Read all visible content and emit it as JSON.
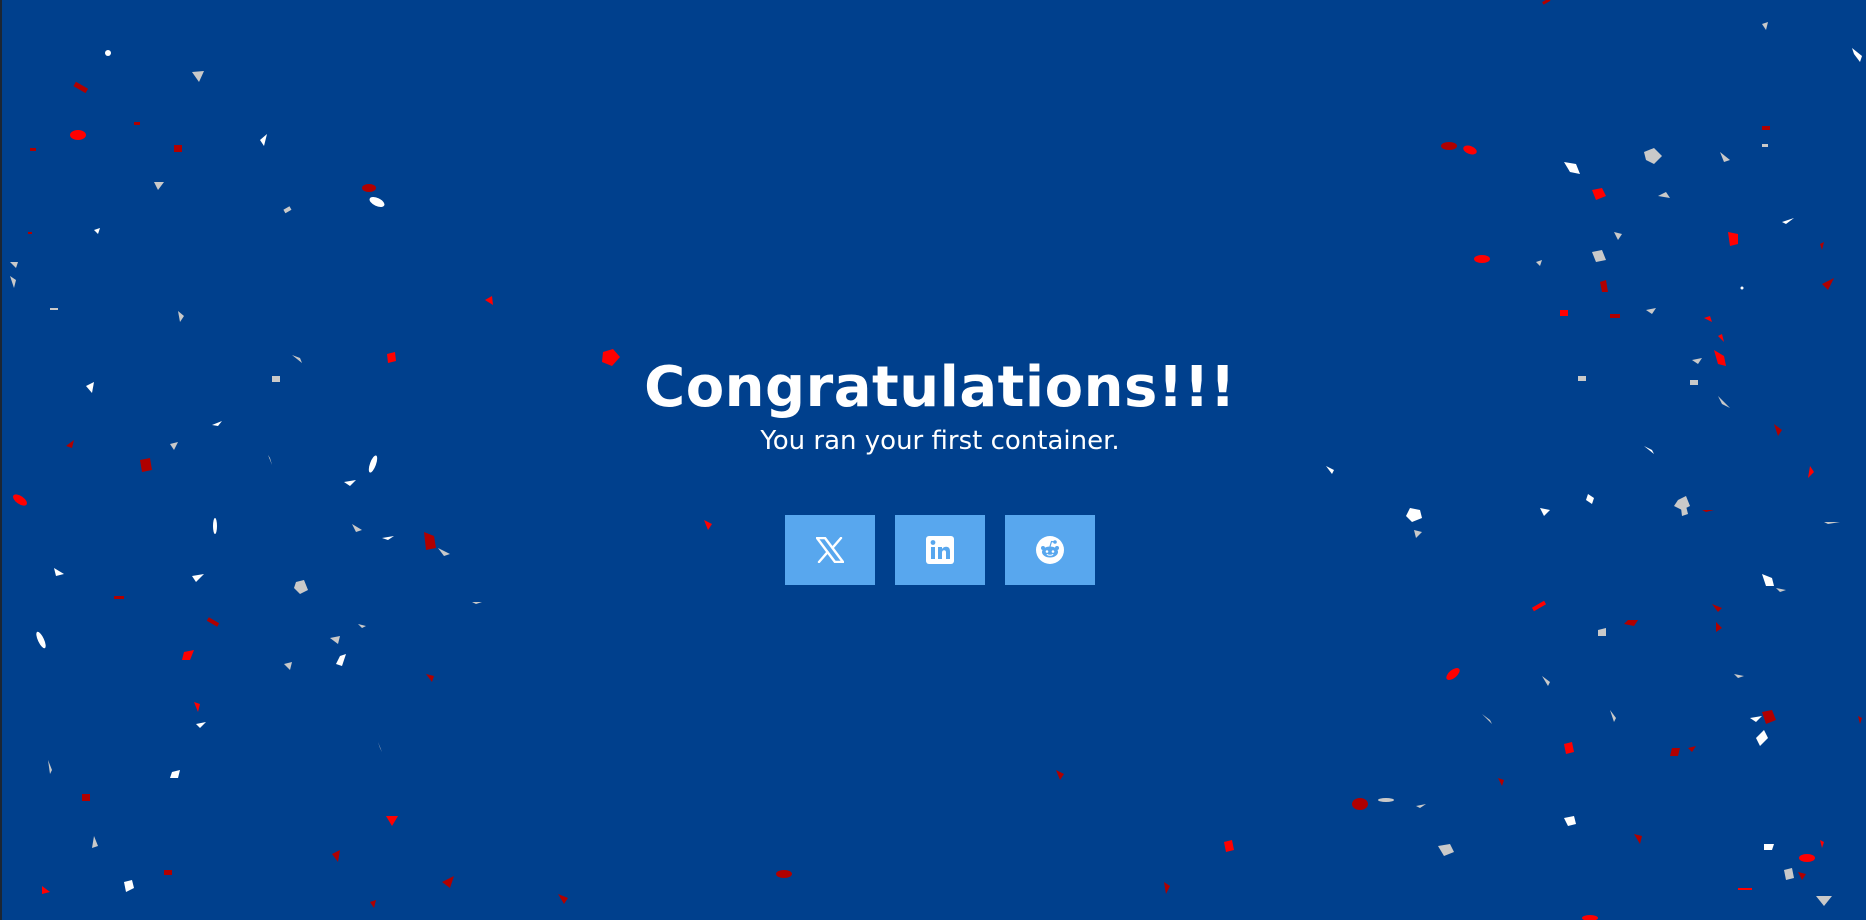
{
  "hero": {
    "title": "Congratulations!!!",
    "subtitle": "You ran your first container."
  },
  "share_buttons": [
    {
      "network": "X",
      "icon": "x-logo-icon"
    },
    {
      "network": "LinkedIn",
      "icon": "linkedin-logo-icon"
    },
    {
      "network": "Reddit",
      "icon": "reddit-logo-icon"
    }
  ],
  "colors": {
    "background": "#00408d",
    "button": "#58a7ee",
    "text": "#ffffff",
    "confetti": [
      "#ff0000",
      "#b00000",
      "#ffffff",
      "#c9c9c9"
    ]
  }
}
